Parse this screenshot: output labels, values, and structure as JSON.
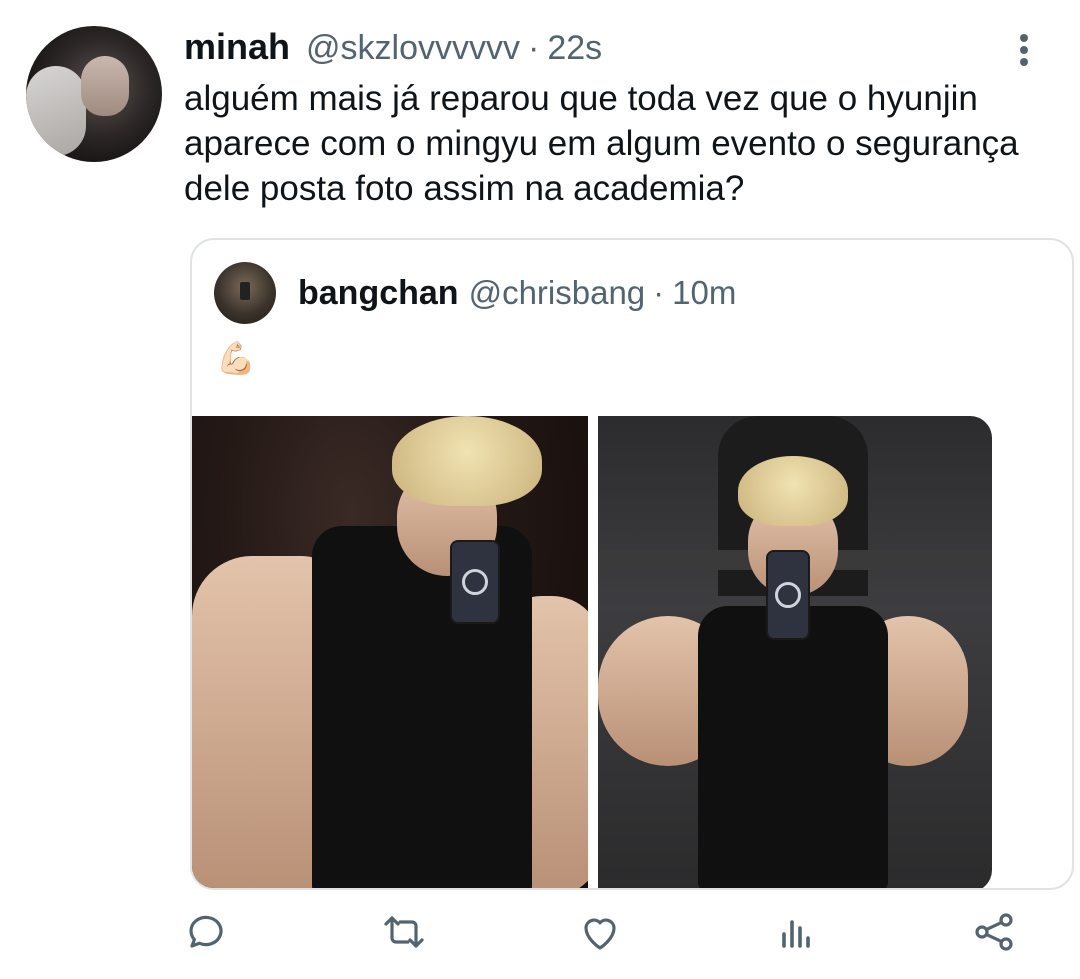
{
  "tweet": {
    "display_name": "minah",
    "handle": "@skzlovvvvvv",
    "separator": "·",
    "time": "22s",
    "text": "alguém mais já reparou que toda vez que o hyunjin aparece com o mingyu em algum evento o segurança dele posta foto assim na academia?"
  },
  "quote": {
    "display_name": "bangchan",
    "handle": "@chrisbang",
    "separator": "·",
    "time": "10m",
    "text": "💪🏻"
  },
  "actions": {
    "reply_icon": "reply-icon",
    "retweet_icon": "retweet-icon",
    "like_icon": "heart-icon",
    "analytics_icon": "analytics-icon",
    "share_icon": "share-icon"
  },
  "colors": {
    "secondary_text": "#536471",
    "border": "#dfe3e6",
    "primary_text": "#0f1419"
  }
}
